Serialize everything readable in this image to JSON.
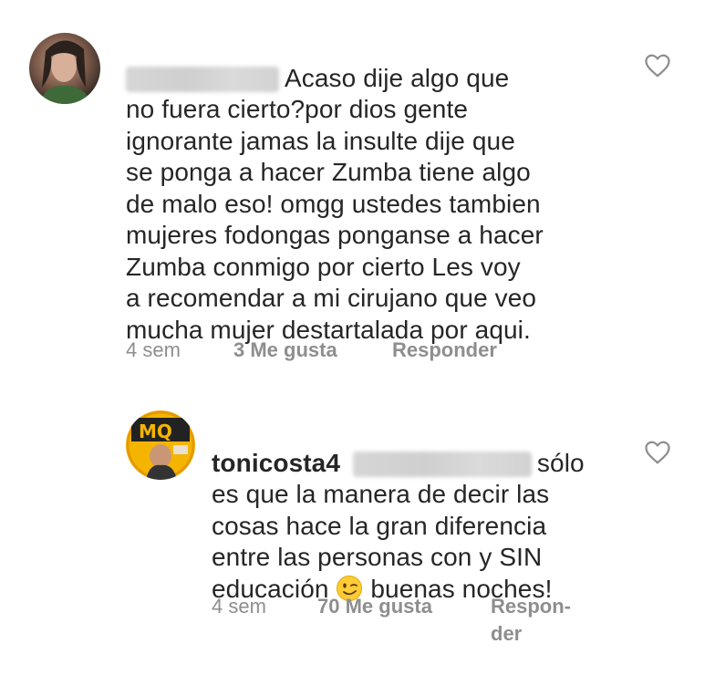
{
  "comments": [
    {
      "text": "Acaso dije algo que\nno fuera cierto?por dios gente\nignorante jamas la insulte dije que\nse ponga a hacer Zumba tiene algo\nde malo eso! omgg ustedes tambien\nmujeres fodongas ponganse a hacer\nZumba conmigo por cierto Les voy\na recomendar a mi cirujano que veo\nmucha mujer destartalada por aqui.",
      "first_line": "Acaso dije algo que",
      "rest": "no fuera cierto?por dios gente\nignorante jamas la insulte dije que\nse ponga a hacer Zumba tiene algo\nde malo eso! omgg ustedes tambien\nmujeres fodongas ponganse a hacer\nZumba conmigo por cierto Les voy\na recomendar a mi cirujano que veo\nmucha mujer destartalada por aqui.",
      "time": "4 sem",
      "likes": "3 Me gusta",
      "reply": "Responder"
    },
    {
      "username": "tonicosta4",
      "first_line_tail": "sólo",
      "body_lines": "es que la manera de decir las\ncosas hace la gran diferencia\nentre las personas con y SIN",
      "last_line_prefix": "educación",
      "last_line_suffix": "buenas noches!",
      "time": "4 sem",
      "likes": "70 Me gusta",
      "reply_line1": "Respon-",
      "reply_line2": "der",
      "avatar_text": "MQ"
    }
  ],
  "icons": {
    "heart": "heart-outline-icon",
    "emoji": "winking-face-emoji"
  },
  "colors": {
    "text": "#262626",
    "meta": "#8e8e8e",
    "blur": "#d4d4d4"
  }
}
